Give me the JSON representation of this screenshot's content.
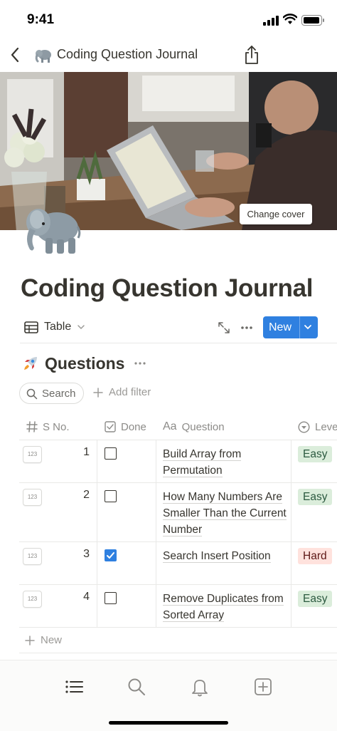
{
  "status_bar": {
    "time": "9:41"
  },
  "nav": {
    "title": "Coding Question Journal",
    "emoji_icon": "elephant-icon"
  },
  "cover": {
    "change_cover_label": "Change cover"
  },
  "page": {
    "title": "Coding Question Journal",
    "icon": "elephant-icon"
  },
  "view_bar": {
    "view_label": "Table",
    "new_label": "New"
  },
  "database": {
    "title": "Questions",
    "icon": "rocket-icon",
    "search_label": "Search",
    "add_filter_label": "Add filter"
  },
  "table": {
    "columns": [
      {
        "label": "S No.",
        "icon": "hash-icon"
      },
      {
        "label": "Done",
        "icon": "checkbox-icon"
      },
      {
        "label": "Question",
        "icon": "text-icon"
      },
      {
        "label": "Leve",
        "icon": "select-icon"
      }
    ],
    "rows": [
      {
        "num_badge": "123",
        "s_no": "1",
        "done": false,
        "question": "Build Array from Permutation",
        "level": "Easy"
      },
      {
        "num_badge": "123",
        "s_no": "2",
        "done": false,
        "question": "How Many Numbers Are Smaller Than the Current Number",
        "level": "Easy"
      },
      {
        "num_badge": "123",
        "s_no": "3",
        "done": true,
        "question": "Search Insert Position",
        "level": "Hard"
      },
      {
        "num_badge": "123",
        "s_no": "4",
        "done": false,
        "question": "Remove Duplicates from Sorted Array",
        "level": "Easy"
      }
    ],
    "add_row_label": "New"
  },
  "bottom_tabs": [
    "list-icon",
    "search-icon",
    "bell-icon",
    "new-page-icon"
  ],
  "colors": {
    "accent": "#2f80e0",
    "easy_bg": "#dbeddb",
    "hard_bg": "#ffe2dd",
    "text": "#37352f"
  }
}
